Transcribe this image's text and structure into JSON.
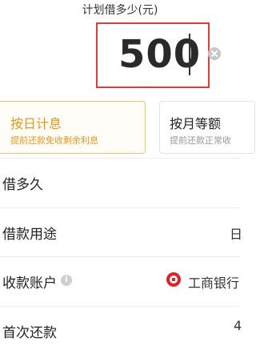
{
  "amount": {
    "title": "计划借多少(元)",
    "value": "500"
  },
  "repayment_plans": [
    {
      "title": "按日计息",
      "subtitle": "提前还款免收剩余利息",
      "selected": true
    },
    {
      "title": "按月等额",
      "subtitle": "提前还款正常收",
      "selected": false
    }
  ],
  "rows": {
    "duration": {
      "label": "借多久"
    },
    "purpose": {
      "label": "借款用途",
      "value": "日"
    },
    "account": {
      "label": "收款账户",
      "value": "工商银行"
    },
    "first_repayment": {
      "label": "首次还款",
      "value": "4"
    }
  },
  "colors": {
    "accent": "#e7961e",
    "highlight_border": "#e23b3b",
    "bank_brand": "#d6262d"
  },
  "icons": {
    "clear": "clear-icon",
    "info": "info-icon",
    "bank": "icbc-bank-icon"
  }
}
